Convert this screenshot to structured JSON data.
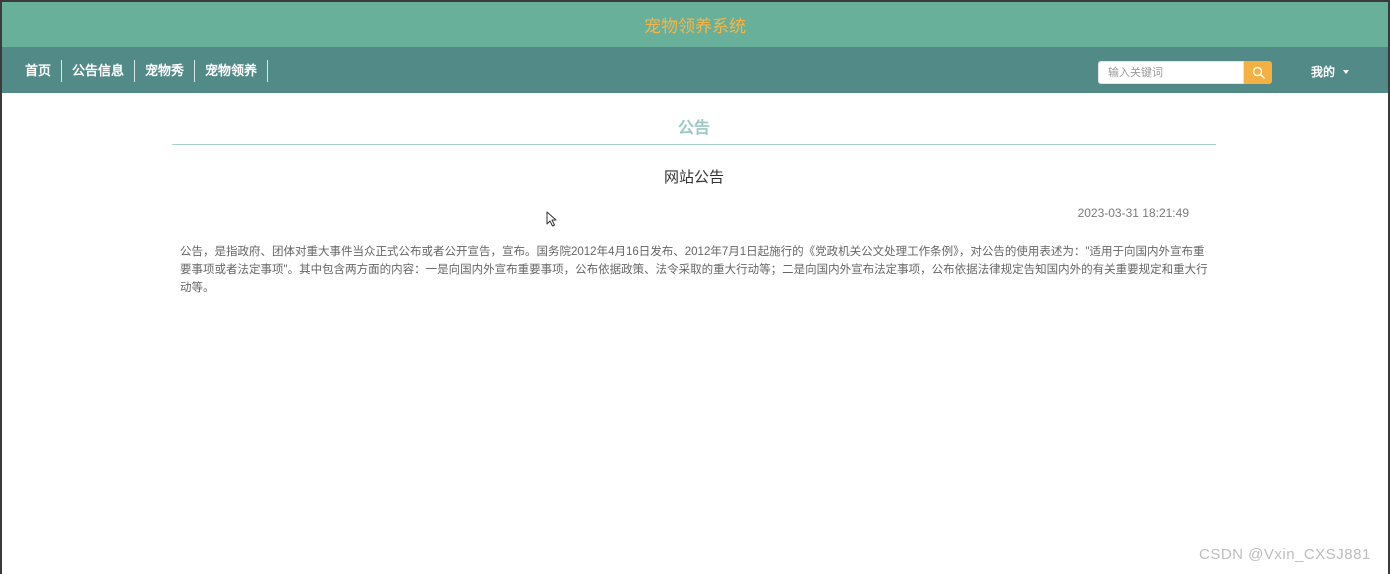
{
  "header": {
    "site_title": "宠物领养系统"
  },
  "nav": {
    "items": [
      {
        "label": "首页"
      },
      {
        "label": "公告信息"
      },
      {
        "label": "宠物秀"
      },
      {
        "label": "宠物领养"
      }
    ],
    "search_placeholder": "输入关键词",
    "search_icon": "search-icon",
    "user_label": "我的"
  },
  "main": {
    "section_title": "公告",
    "notice_title": "网站公告",
    "notice_time": "2023-03-31 18:21:49",
    "notice_body": "公告，是指政府、团体对重大事件当众正式公布或者公开宣告，宣布。国务院2012年4月16日发布、2012年7月1日起施行的《党政机关公文处理工作条例》，对公告的使用表述为：\"适用于向国内外宣布重要事项或者法定事项\"。其中包含两方面的内容：一是向国内外宣布重要事项，公布依据政策、法令采取的重大行动等；二是向国内外宣布法定事项，公布依据法律规定告知国内外的有关重要规定和重大行动等。"
  },
  "watermark": "CSDN @Vxin_CXSJ881",
  "colors": {
    "banner_bg": "#69b09a",
    "nav_bg": "#528a87",
    "title_color": "#f5b547",
    "search_button": "#f5b042",
    "section_title": "#9ac9c4"
  }
}
